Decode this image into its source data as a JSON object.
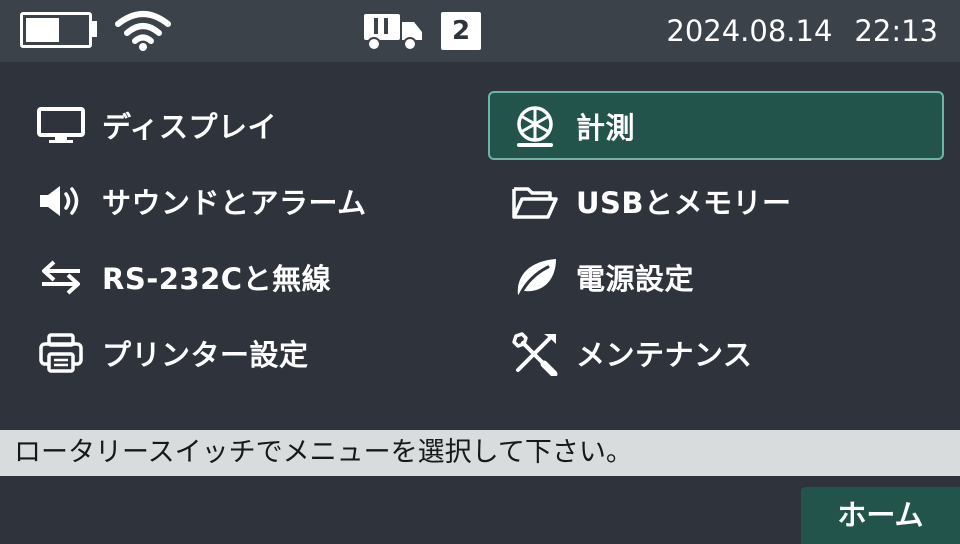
{
  "status": {
    "battery_level": 0.55,
    "wifi": "wifi-icon",
    "vehicle": "truck-icon",
    "vehicle_number": "2",
    "date": "2024.08.14",
    "time": "22:13"
  },
  "menu": {
    "left": [
      {
        "label": "ディスプレイ",
        "icon": "monitor-icon"
      },
      {
        "label": "サウンドとアラーム",
        "icon": "speaker-icon"
      },
      {
        "label": "RS-232Cと無線",
        "icon": "transfer-arrows-icon"
      },
      {
        "label": "プリンター設定",
        "icon": "printer-icon"
      }
    ],
    "right": [
      {
        "label": "計測",
        "icon": "wheel-icon",
        "selected": true
      },
      {
        "label": "USBとメモリー",
        "icon": "folder-icon"
      },
      {
        "label": "電源設定",
        "icon": "leaf-icon"
      },
      {
        "label": "メンテナンス",
        "icon": "tools-icon"
      }
    ]
  },
  "message": "ロータリースイッチでメニューを選択して下さい。",
  "home_label": "ホーム",
  "colors": {
    "background": "#2f343c",
    "status_bar": "#3b424a",
    "accent": "#22544c",
    "accent_border": "#6fb3a5",
    "message_bar": "#d9dcdd"
  }
}
